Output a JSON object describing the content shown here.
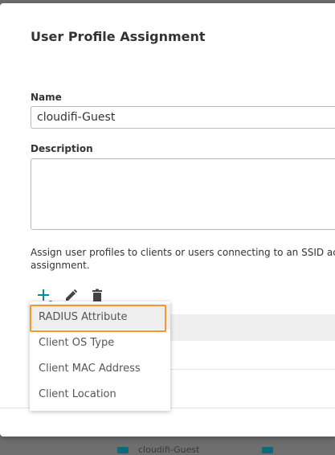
{
  "dialog": {
    "title": "User Profile Assignment",
    "name_label": "Name",
    "name_value": "cloudifi-Guest",
    "description_label": "Description",
    "description_value": "",
    "assign_text": "Assign user profiles to clients or users connecting to an SSID ac assignment."
  },
  "toolbar": {
    "add_icon": "plus-icon",
    "edit_icon": "pencil-icon",
    "delete_icon": "trash-icon"
  },
  "dropdown": {
    "items": [
      {
        "label": "RADIUS Attribute",
        "selected": true
      },
      {
        "label": "Client OS Type",
        "selected": false
      },
      {
        "label": "Client MAC Address",
        "selected": false
      },
      {
        "label": "Client Location",
        "selected": false
      }
    ]
  },
  "background": {
    "peek_text": "cloudifi-Guest"
  },
  "colors": {
    "accent_teal": "#0a8a9a",
    "highlight_orange": "#f0992e",
    "icon_gray": "#444444"
  }
}
